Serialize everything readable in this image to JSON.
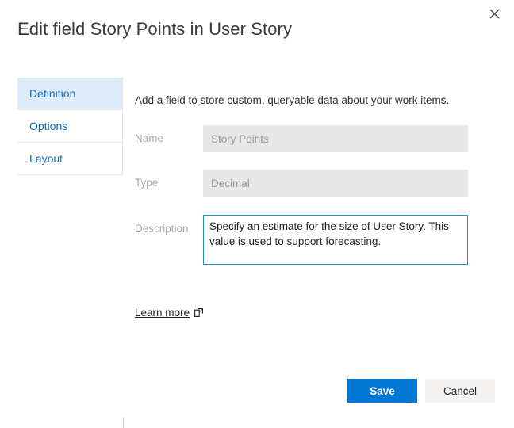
{
  "dialog": {
    "title": "Edit field Story Points in User Story",
    "close_icon": "close-icon"
  },
  "tabs": [
    {
      "label": "Definition",
      "selected": true
    },
    {
      "label": "Options",
      "selected": false
    },
    {
      "label": "Layout",
      "selected": false
    }
  ],
  "content": {
    "intro": "Add a field to store custom, queryable data about your work items.",
    "fields": {
      "name": {
        "label": "Name",
        "value": "Story Points",
        "placeholder": "Story Points"
      },
      "type": {
        "label": "Type",
        "value": "Decimal",
        "placeholder": "Decimal"
      },
      "description": {
        "label": "Description",
        "value": "Specify an estimate for the size of User Story. This value is used to support forecasting.",
        "placeholder": "Description"
      }
    },
    "learn_more": {
      "label": "Learn more",
      "icon": "external-link-icon"
    }
  },
  "footer": {
    "save_label": "Save",
    "cancel_label": "Cancel"
  },
  "colors": {
    "accent": "#0078d4",
    "tab_selected_bg": "#deecf9",
    "tab_text": "#1668b8",
    "focus_border": "#1f92c8",
    "disabled_field_bg": "#e8e8e8",
    "secondary_button_bg": "#f3f2f1"
  }
}
